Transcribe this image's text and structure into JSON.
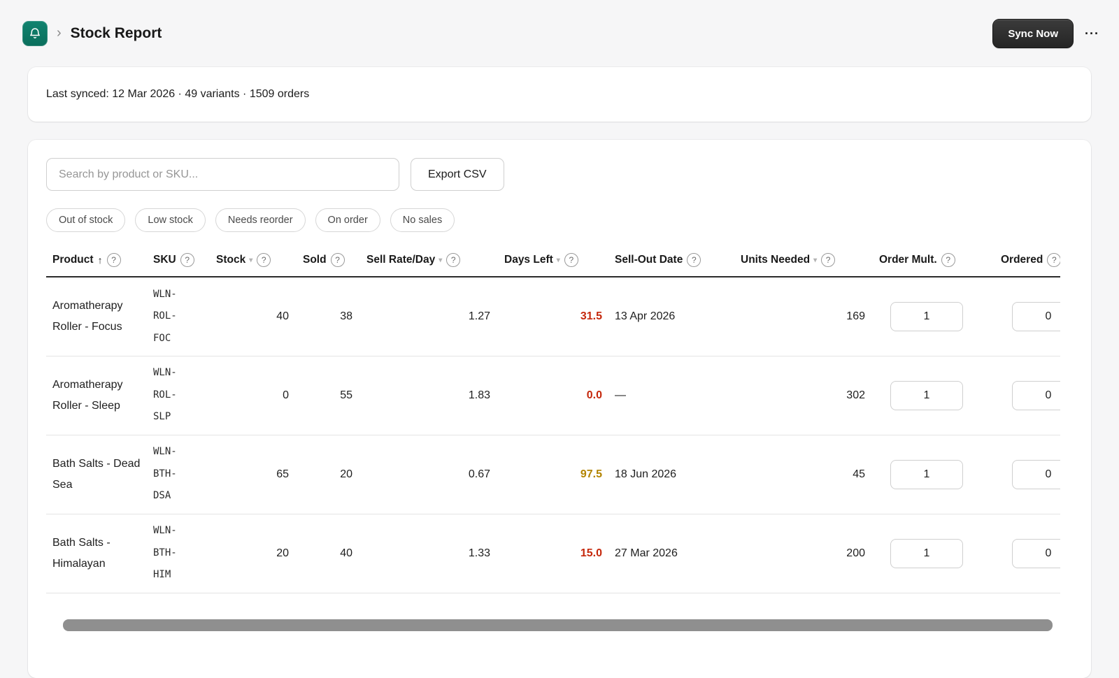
{
  "icons": {
    "breadcrumb_chevron": "›",
    "overflow_menu": "···",
    "sort_asc": "↑",
    "sort_caret": "▾",
    "help": "?"
  },
  "header": {
    "title": "Stock Report",
    "sync_button_label": "Sync Now"
  },
  "sync_banner": {
    "text": "Last synced: 12 Mar 2026 · 49 variants · 1509 orders"
  },
  "toolbar": {
    "search_placeholder": "Search by product or SKU...",
    "export_button_label": "Export CSV"
  },
  "filters": [
    {
      "label": "Out of stock"
    },
    {
      "label": "Low stock"
    },
    {
      "label": "Needs reorder"
    },
    {
      "label": "On order"
    },
    {
      "label": "No sales"
    }
  ],
  "table": {
    "columns": [
      {
        "label": "Product"
      },
      {
        "label": "SKU"
      },
      {
        "label": "Stock"
      },
      {
        "label": "Sold"
      },
      {
        "label": "Sell Rate/Day"
      },
      {
        "label": "Days Left"
      },
      {
        "label": "Sell-Out Date"
      },
      {
        "label": "Units Needed"
      },
      {
        "label": "Order Mult."
      },
      {
        "label": "Ordered"
      }
    ],
    "rows": [
      {
        "product": "Aromatherapy Roller - Focus",
        "sku": "WLN-ROL-FOC",
        "stock": "40",
        "sold": "38",
        "sell_rate_per_day": "1.27",
        "days_left": "31.5",
        "days_left_status": "critical",
        "sell_out_date": "13 Apr 2026",
        "units_needed": "169",
        "order_mult": "1",
        "ordered": "0"
      },
      {
        "product": "Aromatherapy Roller - Sleep",
        "sku": "WLN-ROL-SLP",
        "stock": "0",
        "sold": "55",
        "sell_rate_per_day": "1.83",
        "days_left": "0.0",
        "days_left_status": "critical",
        "sell_out_date": "—",
        "units_needed": "302",
        "order_mult": "1",
        "ordered": "0"
      },
      {
        "product": "Bath Salts - Dead Sea",
        "sku": "WLN-BTH-DSA",
        "stock": "65",
        "sold": "20",
        "sell_rate_per_day": "0.67",
        "days_left": "97.5",
        "days_left_status": "warning",
        "sell_out_date": "18 Jun 2026",
        "units_needed": "45",
        "order_mult": "1",
        "ordered": "0"
      },
      {
        "product": "Bath Salts - Himalayan",
        "sku": "WLN-BTH-HIM",
        "stock": "20",
        "sold": "40",
        "sell_rate_per_day": "1.33",
        "days_left": "15.0",
        "days_left_status": "critical",
        "sell_out_date": "27 Mar 2026",
        "units_needed": "200",
        "order_mult": "1",
        "ordered": "0"
      }
    ]
  },
  "colors": {
    "accent_teal": "#0e7c6b",
    "critical_text": "#c5280c",
    "warning_text": "#b28400"
  }
}
